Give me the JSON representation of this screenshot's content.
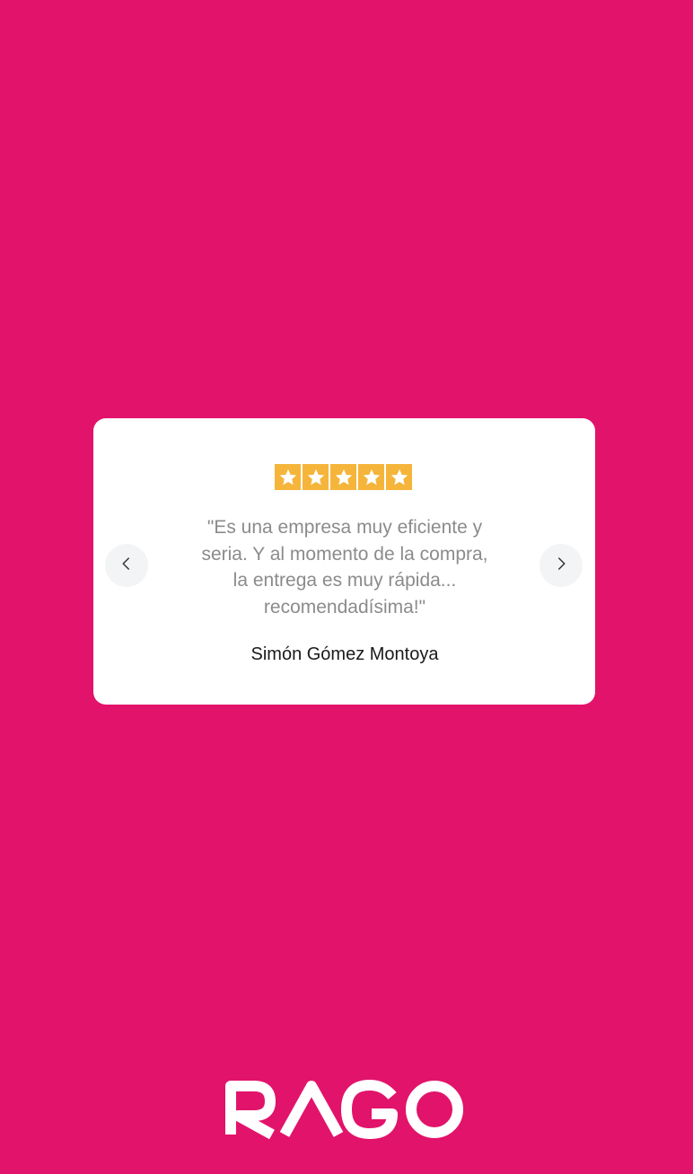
{
  "colors": {
    "background": "#e2136a",
    "card": "#ffffff",
    "star_bg": "#f5b53a",
    "star_fg": "#ffffff",
    "quote_text": "#8b8b8b",
    "author_text": "#1a1a1a",
    "nav_button_bg": "#f3f4f6",
    "logo": "#ffffff"
  },
  "testimonial": {
    "rating": 5,
    "rating_max": 5,
    "quote": "\"Es una empresa muy eficiente y\nseria. Y al momento de la compra,\nla entrega es muy rápida...\nrecomendadísima!\"",
    "author": "Simón Gómez Montoya"
  },
  "icons": {
    "prev": "chevron-left-icon",
    "next": "chevron-right-icon",
    "star": "star-icon"
  },
  "brand": {
    "logo_text": "RAGO"
  }
}
